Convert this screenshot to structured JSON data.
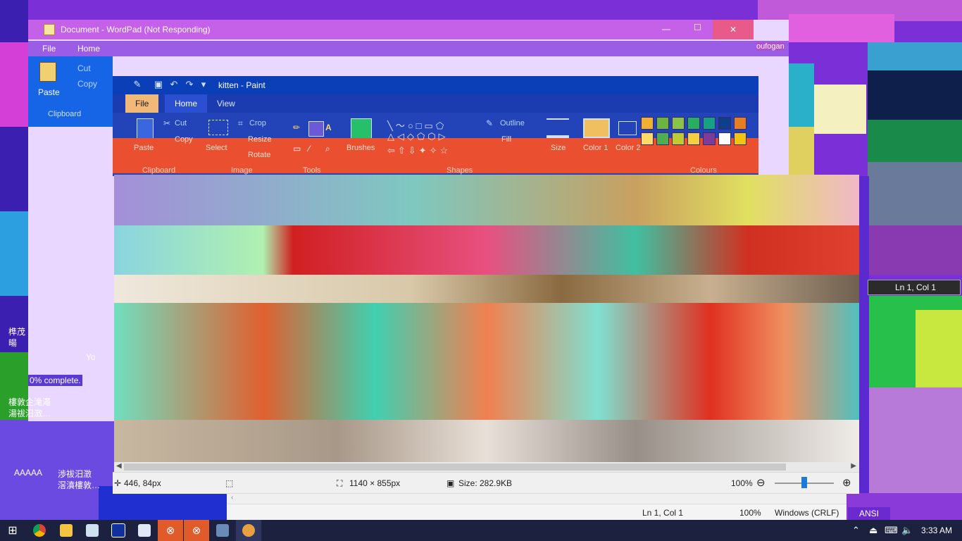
{
  "wordpad": {
    "title": "Document - WordPad (Not Responding)",
    "tabs": [
      "File",
      "Home"
    ],
    "clipboard": {
      "paste": "Paste",
      "cut": "Cut",
      "copy": "Copy",
      "group": "Clipboard"
    },
    "progress_text": "0% complete.",
    "side_text_1": "Yo"
  },
  "paint": {
    "title": "kitten - Paint",
    "tabs": [
      "File",
      "Home",
      "View"
    ],
    "clipboard": {
      "paste": "Paste",
      "cut": "Cut",
      "copy": "Copy",
      "group": "Clipboard"
    },
    "image": {
      "select": "Select",
      "crop": "Crop",
      "resize": "Resize",
      "rotate": "Rotate",
      "group": "Image"
    },
    "tools_group": "Tools",
    "brushes": "Brushes",
    "shapes": {
      "outline": "Outline",
      "fill": "Fill",
      "group": "Shapes"
    },
    "size": "Size",
    "color1": "Color 1",
    "color2": "Color 2",
    "colors_group": "Colours",
    "palette": [
      "#f0b030",
      "#6db33f",
      "#8bc34a",
      "#27ae60",
      "#16a085",
      "#0d3f8a",
      "#e67e22",
      "#ffd966",
      "#4caf50",
      "#c0ca33",
      "#f4d03f",
      "#7d3c98",
      "#ffffff",
      "#f1c40f"
    ],
    "status": {
      "cursor": "446, 84px",
      "dimensions": "1140 × 855px",
      "size": "Size: 282.9KB",
      "zoom": "100%"
    }
  },
  "notepad": {
    "position": "Ln 1, Col 1",
    "zoom": "100%",
    "line_ending": "Windows (CRLF)",
    "encoding": "ANSI"
  },
  "right_panel": {
    "position": "Ln 1, Col 1",
    "truncated": "oufogan"
  },
  "left_fragments": [
    "榫茂",
    "暘",
    "樓敦企滝澠",
    "湯祓汨澂…",
    "AAAAA",
    "渉祓汨澂",
    "滘濆樓敦…"
  ],
  "taskbar": {
    "time": "3:33 AM",
    "items": [
      "start",
      "chrome",
      "file-explorer",
      "notepad",
      "paint-window",
      "wordpad",
      "error-1",
      "error-2",
      "remote-desktop",
      "paint"
    ]
  }
}
